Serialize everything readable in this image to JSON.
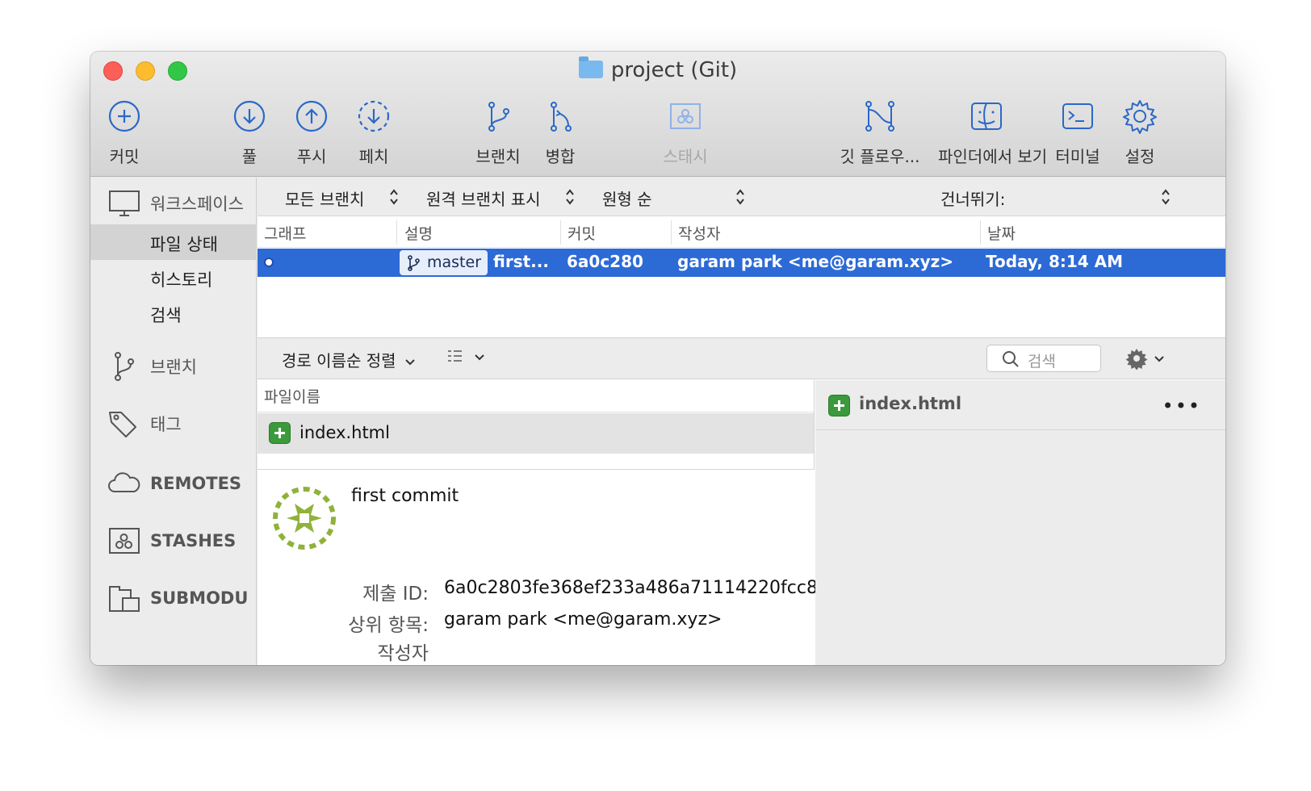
{
  "window": {
    "title": "project (Git)"
  },
  "toolbar": {
    "commit": "커밋",
    "pull": "풀",
    "push": "푸시",
    "fetch": "페치",
    "branch": "브랜치",
    "merge": "병합",
    "stash": "스태시",
    "git_flow": "깃 플로우...",
    "show_in_finder": "파인더에서 보기",
    "terminal": "터미널",
    "settings": "설정"
  },
  "sidebar": {
    "workspace": "워크스페이스",
    "workspace_items": [
      "파일 상태",
      "히스토리",
      "검색"
    ],
    "branches": "브랜치",
    "tags": "태그",
    "remotes": "REMOTES",
    "stashes": "STASHES",
    "submodules": "SUBMODU"
  },
  "filters": {
    "branches": "모든 브랜치",
    "remote": "원격 브랜치 표시",
    "order": "원형 순",
    "jump": "건너뛰기:"
  },
  "columns": {
    "graph": "그래프",
    "description": "설명",
    "commit": "커밋",
    "author": "작성자",
    "date": "날짜"
  },
  "commit_row": {
    "branch": "master",
    "message": "first...",
    "hash": "6a0c280",
    "author": "garam park <me@garam.xyz>",
    "date": "Today, 8:14 AM"
  },
  "files_bar": {
    "sort": "경로 이름순 정렬",
    "search_placeholder": "검색"
  },
  "file_list": {
    "header": "파일이름",
    "files": [
      "index.html"
    ]
  },
  "commit_details": {
    "message": "first commit",
    "commit_id_label": "제출 ID:",
    "commit_id": "6a0c2803fe368ef233a486a71114220fcc8",
    "parents_label": "상위 항목:",
    "parents": "garam park <me@garam.xyz>",
    "author_label": "작성자"
  },
  "diff": {
    "file": "index.html"
  },
  "colors": {
    "accent": "#2c6ad6",
    "icon_blue": "#2a68c8",
    "added_green": "#3b9a3b"
  }
}
